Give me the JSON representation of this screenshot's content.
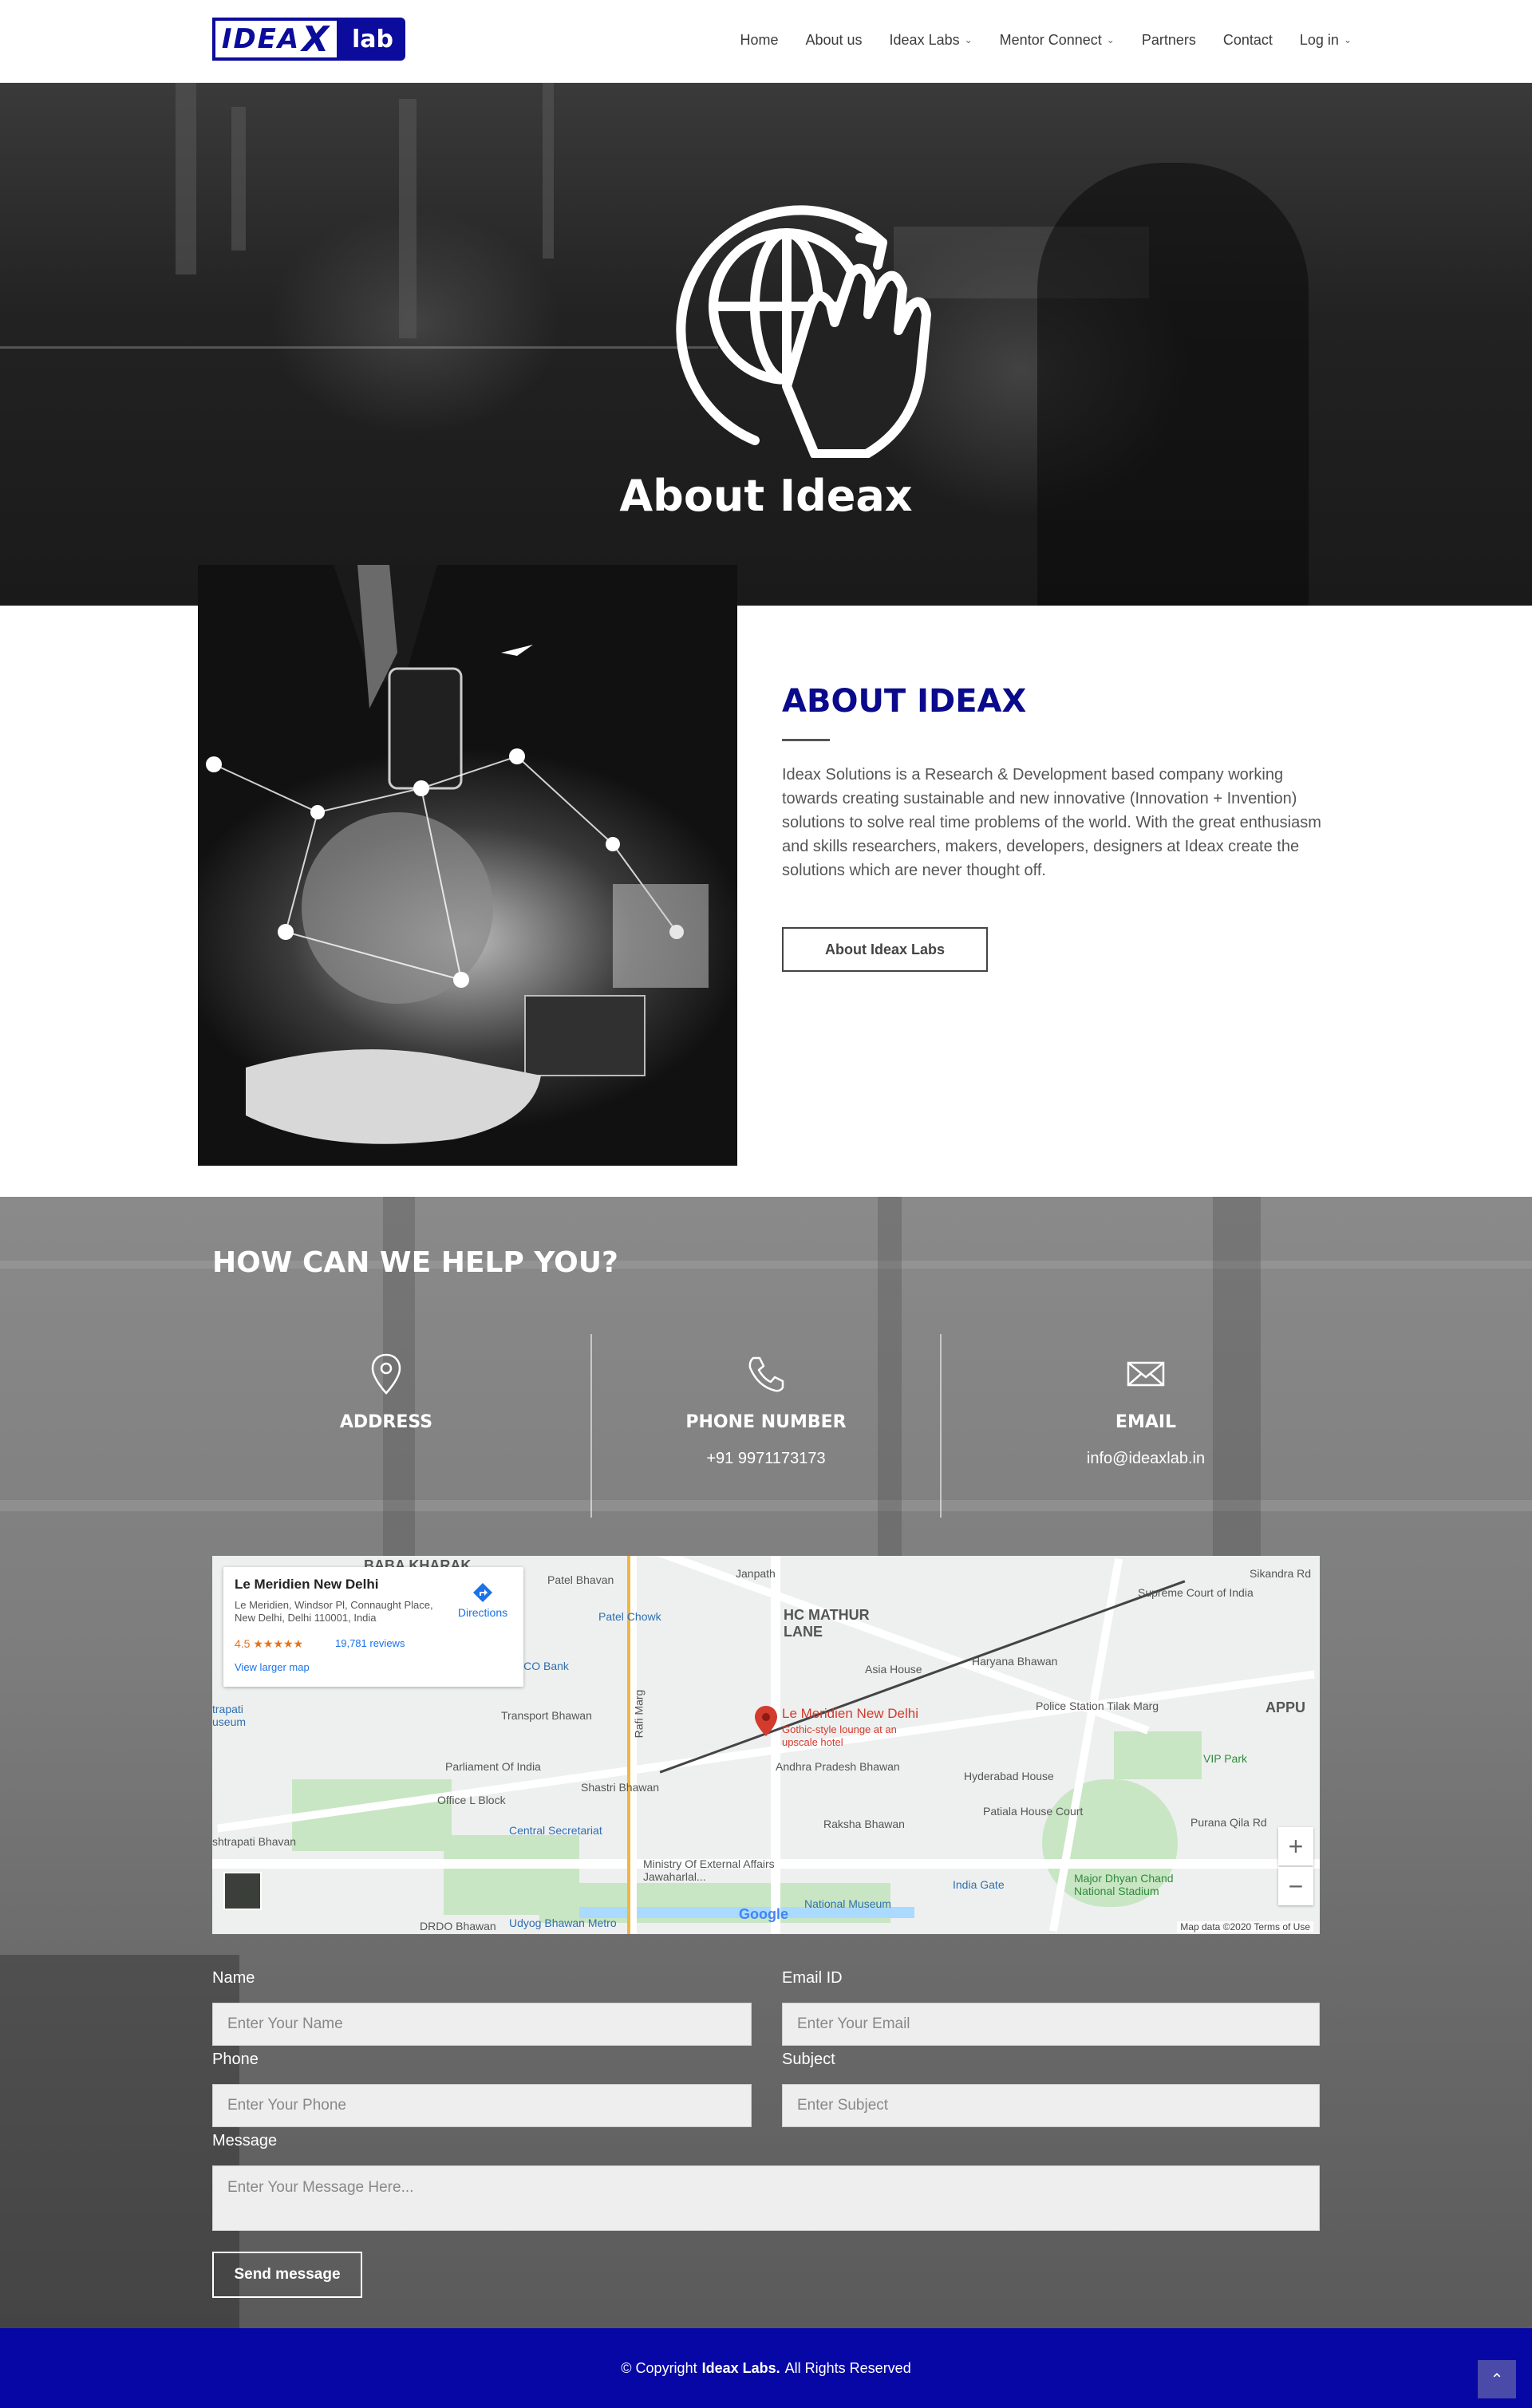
{
  "brand": {
    "logo_left": "IDEA",
    "logo_x": "X",
    "logo_right": "lab",
    "primary_color": "#0707a6"
  },
  "nav": {
    "items": [
      {
        "label": "Home",
        "dropdown": false
      },
      {
        "label": "About us",
        "dropdown": false
      },
      {
        "label": "Ideax Labs",
        "dropdown": true
      },
      {
        "label": "Mentor Connect",
        "dropdown": true
      },
      {
        "label": "Partners",
        "dropdown": false
      },
      {
        "label": "Contact",
        "dropdown": false
      },
      {
        "label": "Log in",
        "dropdown": true
      }
    ],
    "chevron": "⌄"
  },
  "hero": {
    "title": "About Ideax",
    "icon": "globe-hand-icon"
  },
  "about": {
    "heading": "ABOUT IDEAX",
    "text": "Ideax Solutions is a Research & Development based company working towards creating sustainable and new innovative (Innovation + Invention) solutions to solve real time problems of the world. With the great enthusiasm and skills researchers, makers, developers, designers at Ideax create the solutions which are never thought off.",
    "button": "About Ideax Labs"
  },
  "contact": {
    "title": "HOW CAN WE HELP YOU?",
    "address": {
      "label": "ADDRESS",
      "value": "",
      "icon": "location-pin-icon"
    },
    "phone": {
      "label": "PHONE NUMBER",
      "value": "+91 9971173173",
      "icon": "phone-icon"
    },
    "email": {
      "label": "EMAIL",
      "value": "info@ideaxlab.in",
      "icon": "envelope-icon"
    }
  },
  "map": {
    "card": {
      "name": "Le Meridien New Delhi",
      "address": "Le Meridien, Windsor Pl, Connaught Place, New Delhi, Delhi 110001, India",
      "rating": "4.5 ★★★★★",
      "reviews": "19,781 reviews",
      "directions": "Directions",
      "larger_map": "View larger map"
    },
    "pin_name": "Le Meridien New Delhi",
    "pin_sub": "Gothic-style lounge at an upscale hotel",
    "labels": {
      "baba_kharak": "BABA KHARAK",
      "patel_bhavan": "Patel Bhavan",
      "patel_chowk": "Patel Chowk",
      "hc_mathur": "HC MATHUR LANE",
      "janpath": "Janpath",
      "sikandra": "Sikandra Rd",
      "supreme_court": "Supreme Court of India",
      "uco_bank": "UCO Bank",
      "asia_house": "Asia House",
      "haryana_bhawan": "Haryana Bhawan",
      "rastrapati": "trapati useum",
      "transport_bhawan": "Transport Bhawan",
      "police_station": "Police Station Tilak Marg",
      "appu": "APPU",
      "vip_park": "VIP Park",
      "parliament": "Parliament Of India",
      "andhra": "Andhra Pradesh Bhawan",
      "hyderabad_house": "Hyderabad House",
      "office_l_block": "Office L Block",
      "shastri_bhawan": "Shastri Bhawan",
      "patiala_house": "Patiala House Court",
      "central_secretariat": "Central Secretariat",
      "raksha_bhawan": "Raksha Bhawan",
      "purana_qila": "Purana Qila Rd",
      "rashtrapati_bhavan": "shtrapati Bhavan",
      "ministry": "Ministry Of External Affairs Jawaharlal...",
      "india_gate": "India Gate",
      "major_dhyan": "Major Dhyan Chand National Stadium",
      "national_museum": "National Museum",
      "drdo": "DRDO Bhawan",
      "udyog": "Udyog Bhawan Metro",
      "rafi_marg": "Rafi Marg",
      "google": "Google",
      "map_data": "Map data ©2020    Terms of Use"
    },
    "zoom_in": "+",
    "zoom_out": "−"
  },
  "form": {
    "name_label": "Name",
    "name_placeholder": "Enter Your Name",
    "email_label": "Email ID",
    "email_placeholder": "Enter Your Email",
    "phone_label": "Phone",
    "phone_placeholder": "Enter Your Phone",
    "subject_label": "Subject",
    "subject_placeholder": "Enter Subject",
    "message_label": "Message",
    "message_placeholder": "Enter Your Message Here...",
    "send": "Send message"
  },
  "footer": {
    "pre": "© Copyright",
    "brand": "Ideax Labs.",
    "post": "All Rights Reserved",
    "to_top": "⌃"
  }
}
